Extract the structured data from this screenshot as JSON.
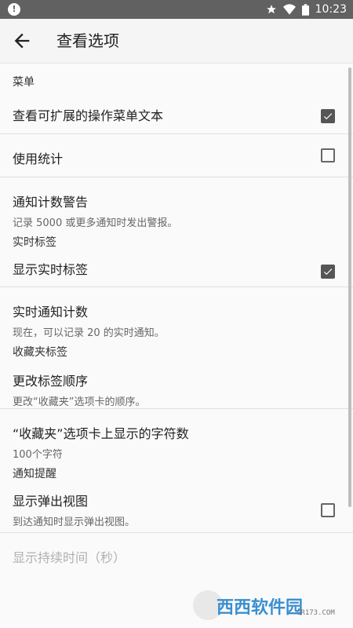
{
  "status_bar": {
    "time": "10:23",
    "left_icon": "!"
  },
  "toolbar": {
    "title": "查看选项",
    "back_icon": "arrow-left"
  },
  "sections": [
    {
      "header": "菜单",
      "items": [
        {
          "title": "查看可扩展的操作菜单文本",
          "summary": "",
          "checkbox": "checked"
        },
        {
          "title": "使用统计",
          "summary": "",
          "checkbox": "unchecked"
        },
        {
          "title": "通知计数警告",
          "summary": "记录 5000 或更多通知时发出警报。",
          "checkbox": "none"
        }
      ]
    },
    {
      "header": "实时标签",
      "items": [
        {
          "title": "显示实时标签",
          "summary": "",
          "checkbox": "checked"
        },
        {
          "title": "实时通知计数",
          "summary": "现在，可以记录 20 的实时通知。",
          "checkbox": "none"
        }
      ]
    },
    {
      "header": "收藏夹标签",
      "items": [
        {
          "title": "更改标签顺序",
          "summary": "更改“收藏夹”选项卡的顺序。",
          "checkbox": "none"
        },
        {
          "title": "“收藏夹”选项卡上显示的字符数",
          "summary": "100个字符",
          "checkbox": "none"
        }
      ]
    },
    {
      "header": "通知提醒",
      "items": [
        {
          "title": "显示弹出视图",
          "summary": "到达通知时显示弹出视图。",
          "checkbox": "unchecked"
        },
        {
          "title": "显示持续时间（秒）",
          "summary": "",
          "checkbox": "none",
          "disabled": true
        }
      ]
    }
  ],
  "watermark": {
    "text": "西西软件园",
    "sub": "CR173.COM"
  },
  "colors": {
    "checkbox_checked": "#555555",
    "toolbar_bg": "#f5f5f5",
    "statusbar_bg": "#616161"
  }
}
